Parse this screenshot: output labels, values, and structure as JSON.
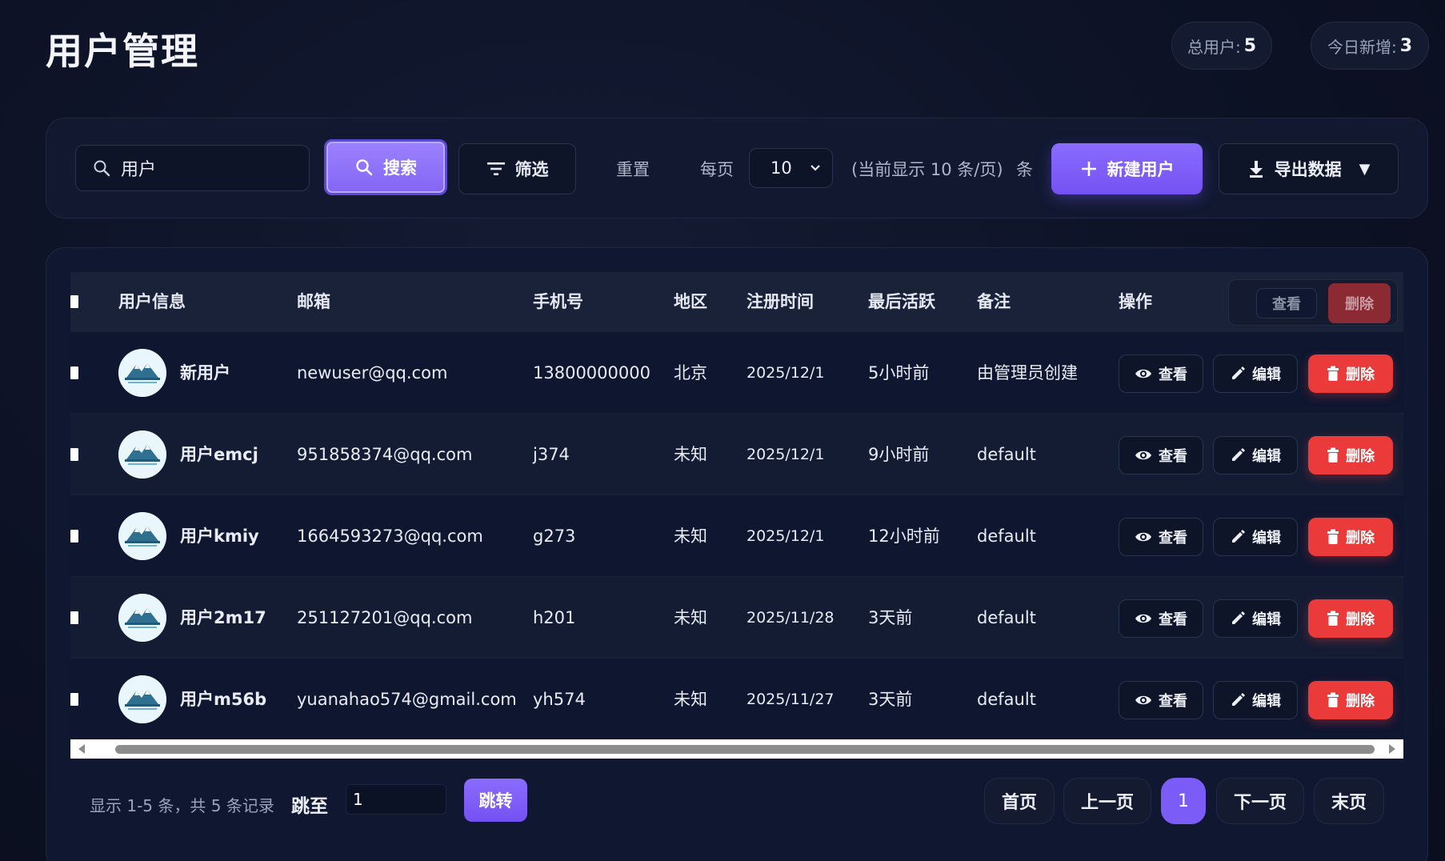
{
  "header": {
    "title": "用户管理",
    "stats": {
      "total_label": "总用户:",
      "total_value": "5",
      "today_label": "今日新增:",
      "today_value": "3"
    }
  },
  "toolbar": {
    "search_value": "用户",
    "search_button": "搜索",
    "filter_button": "筛选",
    "reset_button": "重置",
    "per_page_label": "每页",
    "per_page_value": "10",
    "per_page_hint": "(当前显示 10 条/页)",
    "per_page_unit": "条",
    "new_user_button": "新建用户",
    "export_button": "导出数据"
  },
  "table": {
    "columns": [
      "用户信息",
      "邮箱",
      "手机号",
      "地区",
      "注册时间",
      "最后活跃",
      "备注",
      "操作"
    ],
    "header_actions": {
      "view": "查看",
      "delete": "删除"
    },
    "action_labels": {
      "view": "查看",
      "edit": "编辑",
      "delete": "删除"
    },
    "rows": [
      {
        "name": "新用户",
        "email": "newuser@qq.com",
        "phone": "13800000000",
        "region": "北京",
        "registered": "2025/12/1",
        "last_active": "5小时前",
        "note": "由管理员创建"
      },
      {
        "name": "用户emcj",
        "email": "951858374@qq.com",
        "phone": "j374",
        "region": "未知",
        "registered": "2025/12/1",
        "last_active": "9小时前",
        "note": "default"
      },
      {
        "name": "用户kmiy",
        "email": "1664593273@qq.com",
        "phone": "g273",
        "region": "未知",
        "registered": "2025/12/1",
        "last_active": "12小时前",
        "note": "default"
      },
      {
        "name": "用户2m17",
        "email": "251127201@qq.com",
        "phone": "h201",
        "region": "未知",
        "registered": "2025/11/28",
        "last_active": "3天前",
        "note": "default"
      },
      {
        "name": "用户m56b",
        "email": "yuanahao574@gmail.com",
        "phone": "yh574",
        "region": "未知",
        "registered": "2025/11/27",
        "last_active": "3天前",
        "note": "default"
      }
    ]
  },
  "pagination": {
    "info": "显示 1-5 条，共 5 条记录",
    "jump_label": "跳至",
    "jump_value": "1",
    "jump_button": "跳转",
    "first": "首页",
    "prev": "上一页",
    "current": "1",
    "next": "下一页",
    "last": "末页"
  },
  "colors": {
    "accent": "#7b5cf6",
    "danger": "#ea3a3a",
    "background": "#0c1124"
  }
}
